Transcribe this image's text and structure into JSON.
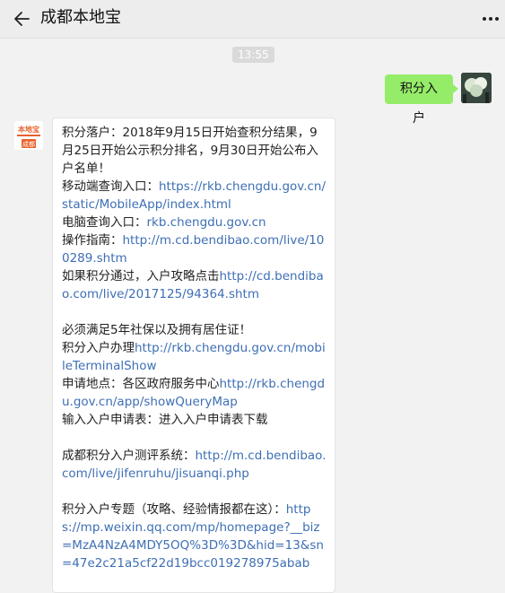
{
  "header": {
    "back_icon": "back-arrow-icon",
    "title": "成都本地宝",
    "more_icon": "more-dots-icon"
  },
  "chat": {
    "timestamp": "13:55",
    "outgoing_message": "积分入户",
    "incoming_avatar_text": {
      "line1": "本地宝",
      "line2": "成都"
    },
    "incoming": {
      "p1": "积分落户：2018年9月15日开始查积分结果，9月25日开始公示积分排名，9月30日开始公布入户名单！",
      "mobile_label": "移动端查询入口：",
      "mobile_link": "https://rkb.chengdu.gov.cn/static/MobileApp/index.html",
      "pc_label": "电脑查询入口：",
      "pc_link": "rkb.chengdu.gov.cn",
      "guide_label": "操作指南：",
      "guide_link": "http://m.cd.bendibao.com/live/100289.shtm",
      "pass_label": "如果积分通过，入户攻略点击",
      "pass_link": "http://cd.bendibao.com/live/2017125/94364.shtm",
      "require": "必须满足5年社保以及拥有居住证！",
      "apply_label": "积分入户办理",
      "apply_link": "http://rkb.chengdu.gov.cn/mobileTerminalShow",
      "place_label": "申请地点：各区政府服务中心",
      "place_link": "http://rkb.chengdu.gov.cn/app/showQueryMap",
      "form_text": "输入入户申请表：进入入户申请表下载",
      "calc_label": "成都积分入户测评系统：",
      "calc_link": "http://m.cd.bendibao.com/live/jifenruhu/jisuanqi.php",
      "topic_label": "积分入户专题（攻略、经验情报都在这）：",
      "topic_link": "https://mp.weixin.qq.com/mp/homepage?__biz=MzA4NzA4MDY5OQ%3D%3D&hid=13&sn=47e2c21a5cf22d19bcc019278975abab"
    }
  },
  "colors": {
    "link": "#3e6fb5",
    "outgoing_bubble": "#95ec69",
    "logo_orange": "#e8612c"
  }
}
